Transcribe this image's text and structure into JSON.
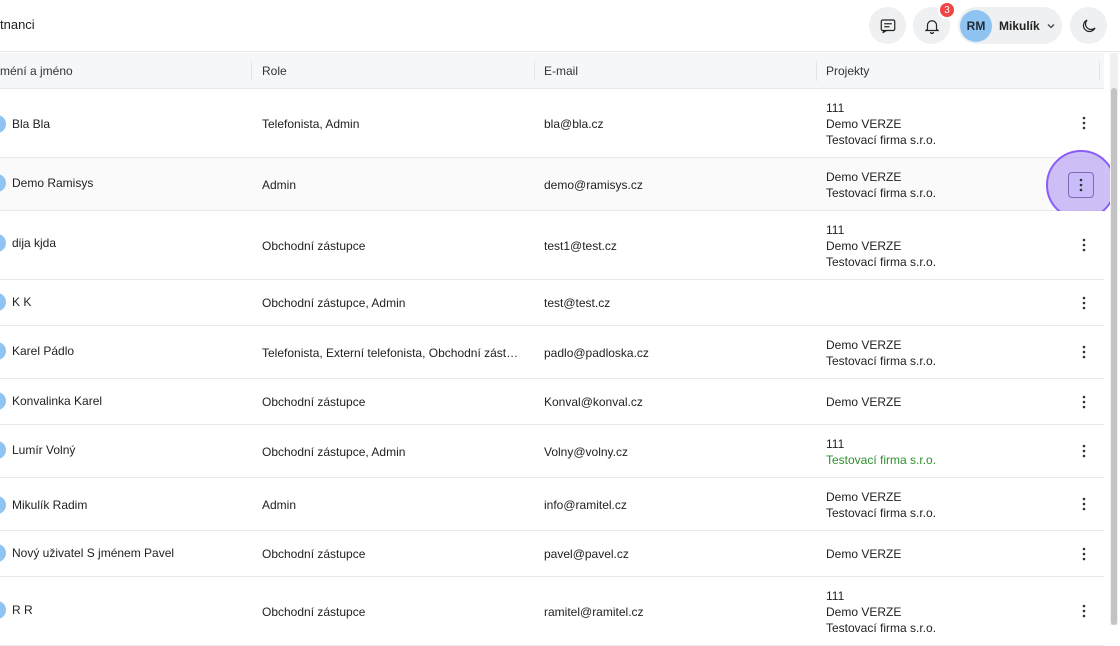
{
  "header": {
    "title": "tnanci",
    "notifications_count": "3",
    "user": {
      "initials": "RM",
      "name": "Mikulík"
    }
  },
  "table": {
    "columns": [
      "méní a jméno",
      "Role",
      "E-mail",
      "Projekty"
    ],
    "rows": [
      {
        "name": "Bla Bla",
        "role": "Telefonista, Admin",
        "email": "bla@bla.cz",
        "projects": [
          "111",
          "Demo VERZE",
          "Testovací firma s.r.o."
        ]
      },
      {
        "name": "Demo Ramisys",
        "role": "Admin",
        "email": "demo@ramisys.cz",
        "projects": [
          "Demo VERZE",
          "Testovací firma s.r.o."
        ]
      },
      {
        "name": "dija kjda",
        "role": "Obchodní zástupce",
        "email": "test1@test.cz",
        "projects": [
          "111",
          "Demo VERZE",
          "Testovací firma s.r.o."
        ]
      },
      {
        "name": "K K",
        "role": "Obchodní zástupce, Admin",
        "email": "test@test.cz",
        "projects": []
      },
      {
        "name": "Karel Pádlo",
        "role": "Telefonista, Externí telefonista, Obchodní zást…",
        "email": "padlo@padloska.cz",
        "projects": [
          "Demo VERZE",
          "Testovací firma s.r.o."
        ]
      },
      {
        "name": "Konvalinka Karel",
        "role": "Obchodní zástupce",
        "email": "Konval@konval.cz",
        "projects": [
          "Demo VERZE"
        ]
      },
      {
        "name": "Lumír Volný",
        "role": "Obchodní zástupce, Admin",
        "email": "Volny@volny.cz",
        "projects": [
          "111",
          "Testovací firma s.r.o."
        ]
      },
      {
        "name": "Mikulík Radim",
        "role": "Admin",
        "email": "info@ramitel.cz",
        "projects": [
          "Demo VERZE",
          "Testovací firma s.r.o."
        ]
      },
      {
        "name": "Nový uživatel S jménem Pavel",
        "role": "Obchodní zástupce",
        "email": "pavel@pavel.cz",
        "projects": [
          "Demo VERZE"
        ]
      },
      {
        "name": "R R",
        "role": "Obchodní zástupce",
        "email": "ramitel@ramitel.cz",
        "projects": [
          "111",
          "Demo VERZE",
          "Testovací firma s.r.o."
        ]
      }
    ]
  },
  "colors": {
    "accent_focus": "#8b5cf6",
    "avatar": "#8fc4f2",
    "green_text": "#2f8f2f",
    "badge": "#ef4444"
  },
  "icons": [
    "chat-icon",
    "bell-icon",
    "chevron-down-icon",
    "moon-icon",
    "more-vertical-icon"
  ]
}
